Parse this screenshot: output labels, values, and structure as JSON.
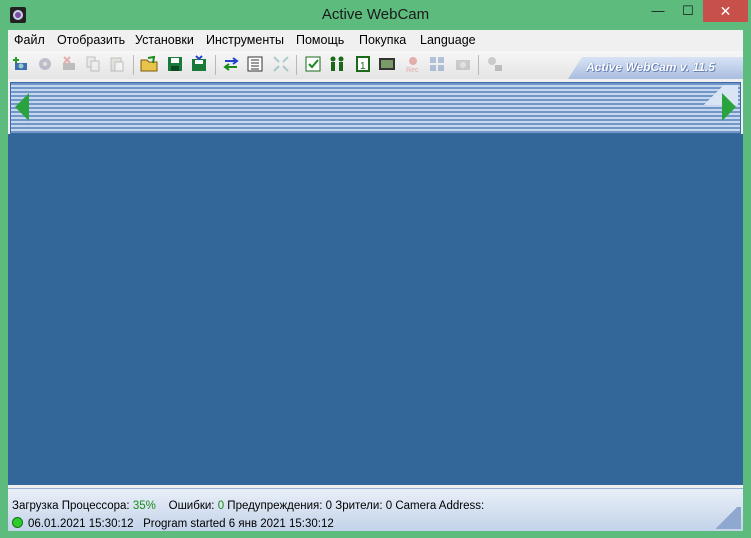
{
  "window": {
    "title": "Active WebCam",
    "minimize": "—",
    "maximize": "☐",
    "close": "✕"
  },
  "menu": [
    "Файл",
    "Отобразить",
    "Установки",
    "Инструменты",
    "Помощь",
    "Покупка",
    "Language"
  ],
  "toolbar": {
    "brand": "Active WebCam v. 11.5",
    "icons": [
      "add-camera-icon",
      "camera-settings-icon",
      "delete-camera-icon",
      "copy-icon",
      "paste-icon",
      "open-icon",
      "save-icon",
      "save-all-icon",
      "swap-icon",
      "list-icon",
      "fullscreen-icon",
      "schedule-icon",
      "users-icon",
      "single-view-icon",
      "image-icon",
      "record-icon",
      "multi-view-icon",
      "snapshot-icon",
      "network-icon"
    ]
  },
  "status": {
    "cpu_label": "Загрузка Процессора:",
    "cpu_value": "35%",
    "errors_label": "Ошибки:",
    "errors_value": "0",
    "warnings_label": "Предупреждения:",
    "warnings_value": "0",
    "viewers_label": "Зрители:",
    "viewers_value": "0",
    "camera_address_label": "Camera Address:",
    "datetime": "06.01.2021 15:30:12",
    "message": "Program started  6 янв 2021 15:30:12"
  },
  "colors": {
    "frame": "#5dbb7e",
    "video_bg": "#336699",
    "close": "#c7504a",
    "arrow": "#2aa33e"
  }
}
